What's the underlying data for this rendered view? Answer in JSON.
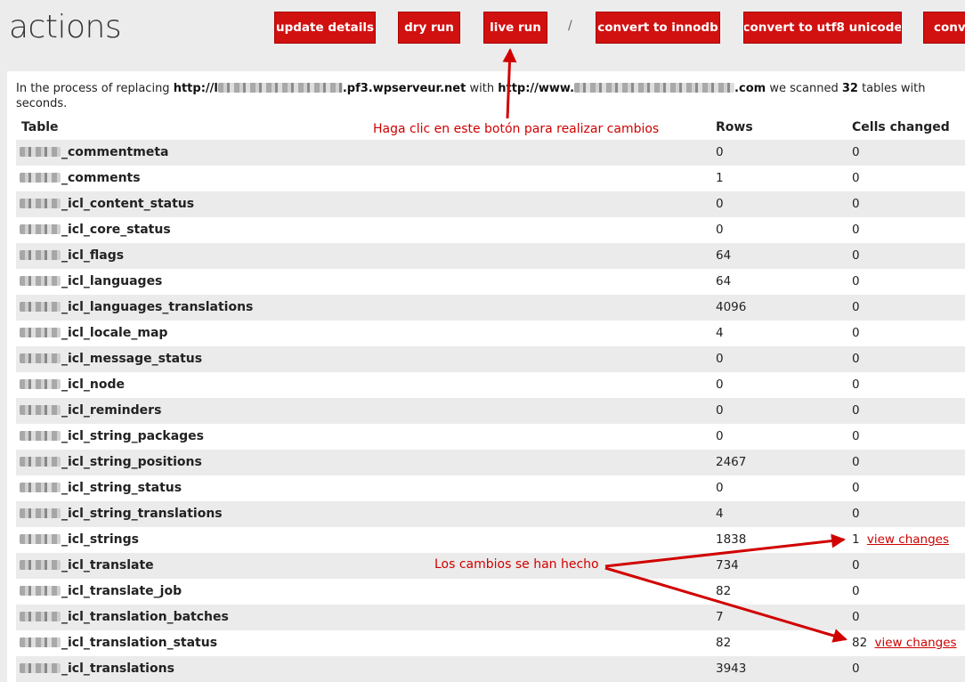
{
  "header": {
    "title": "actions",
    "buttons": {
      "update": "update details",
      "dry_run": "dry run",
      "live_run": "live run",
      "separator": "/",
      "innodb": "convert to innodb",
      "utf8": "convert to utf8 unicode",
      "conv": "conve"
    }
  },
  "summary": {
    "prefix": "In the process of replacing",
    "from_start": "http://l",
    "from_end": ".pf3.wpserveur.net",
    "with": "with",
    "to_start": "http://www.",
    "to_end": ".com",
    "scanned": "we scanned",
    "count": "32",
    "tail": "tables with",
    "line2": "seconds."
  },
  "table": {
    "headers": {
      "table": "Table",
      "rows": "Rows",
      "changed": "Cells changed"
    },
    "view_changes_label": "view changes",
    "rows": [
      {
        "name": "_commentmeta",
        "rows": "0",
        "changed": "0"
      },
      {
        "name": "_comments",
        "rows": "1",
        "changed": "0"
      },
      {
        "name": "_icl_content_status",
        "rows": "0",
        "changed": "0"
      },
      {
        "name": "_icl_core_status",
        "rows": "0",
        "changed": "0"
      },
      {
        "name": "_icl_flags",
        "rows": "64",
        "changed": "0"
      },
      {
        "name": "_icl_languages",
        "rows": "64",
        "changed": "0"
      },
      {
        "name": "_icl_languages_translations",
        "rows": "4096",
        "changed": "0"
      },
      {
        "name": "_icl_locale_map",
        "rows": "4",
        "changed": "0"
      },
      {
        "name": "_icl_message_status",
        "rows": "0",
        "changed": "0"
      },
      {
        "name": "_icl_node",
        "rows": "0",
        "changed": "0"
      },
      {
        "name": "_icl_reminders",
        "rows": "0",
        "changed": "0"
      },
      {
        "name": "_icl_string_packages",
        "rows": "0",
        "changed": "0"
      },
      {
        "name": "_icl_string_positions",
        "rows": "2467",
        "changed": "0"
      },
      {
        "name": "_icl_string_status",
        "rows": "0",
        "changed": "0"
      },
      {
        "name": "_icl_string_translations",
        "rows": "4",
        "changed": "0"
      },
      {
        "name": "_icl_strings",
        "rows": "1838",
        "changed": "1",
        "link": true
      },
      {
        "name": "_icl_translate",
        "rows": "734",
        "changed": "0"
      },
      {
        "name": "_icl_translate_job",
        "rows": "82",
        "changed": "0"
      },
      {
        "name": "_icl_translation_batches",
        "rows": "7",
        "changed": "0"
      },
      {
        "name": "_icl_translation_status",
        "rows": "82",
        "changed": "82",
        "link": true
      },
      {
        "name": "_icl_translations",
        "rows": "3943",
        "changed": "0"
      }
    ]
  },
  "annotations": {
    "click_hint": "Haga clic en este botón para realizar cambios",
    "changes_done": "Los cambios se han hecho"
  },
  "colors": {
    "button": "#d11010",
    "annotation": "#d10000",
    "link": "#cc0000"
  }
}
